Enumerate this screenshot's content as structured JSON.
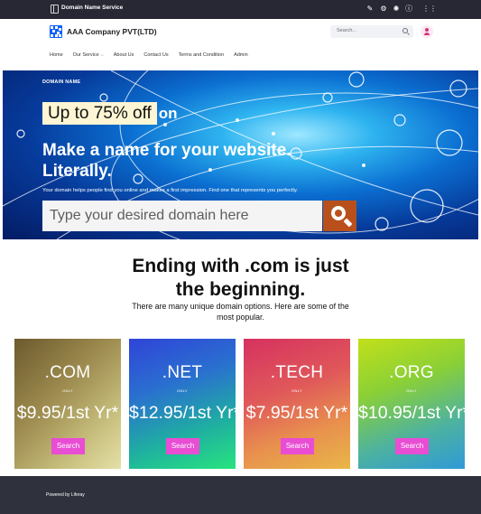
{
  "control_bar": {
    "site_name": "Domain Name Service",
    "icons": [
      "panel-icon",
      "edit-icon",
      "gear-icon",
      "simulation-icon",
      "info-icon",
      "apps-grid-icon"
    ]
  },
  "header": {
    "company_name": "AAA Company PVT(LTD)",
    "search_placeholder": "Search...",
    "nav": [
      "Home",
      "Our Service",
      "About Us",
      "Contact Us",
      "Terms and Condition",
      "Admin"
    ]
  },
  "hero": {
    "eyebrow": "DOMAIN NAME",
    "promo_highlight": "Up to 75% off",
    "promo_tail": "on",
    "headline": "Make a name for your website. Literally.",
    "subtext": "Your domain helps people find you online and makes a first impression. Find one that represents you perfectly.",
    "input_placeholder": "Type your desired domain here"
  },
  "intro": {
    "title": "Ending with .com is just the beginning.",
    "subtitle": "There are many unique domain options. Here are some of the most popular."
  },
  "cards": [
    {
      "tld": ".COM",
      "only": "ONLY",
      "price": "$9.95/1st Yr*",
      "button": "Search"
    },
    {
      "tld": ".NET",
      "only": "ONLY",
      "price": "$12.95/1st Yr*",
      "button": "Search"
    },
    {
      "tld": ".TECH",
      "only": "ONLY",
      "price": "$7.95/1st Yr*",
      "button": "Search"
    },
    {
      "tld": ".ORG",
      "only": "ONLY",
      "price": "$10.95/1st Yr*",
      "button": "Search"
    }
  ],
  "footer": {
    "powered_by": "Powered by Liferay"
  },
  "colors": {
    "control_bar": "#272833",
    "brand_blue": "#0b5fff",
    "search_button": "#b9501c",
    "card_button": "#e84dd3",
    "footer": "#2f313d"
  }
}
